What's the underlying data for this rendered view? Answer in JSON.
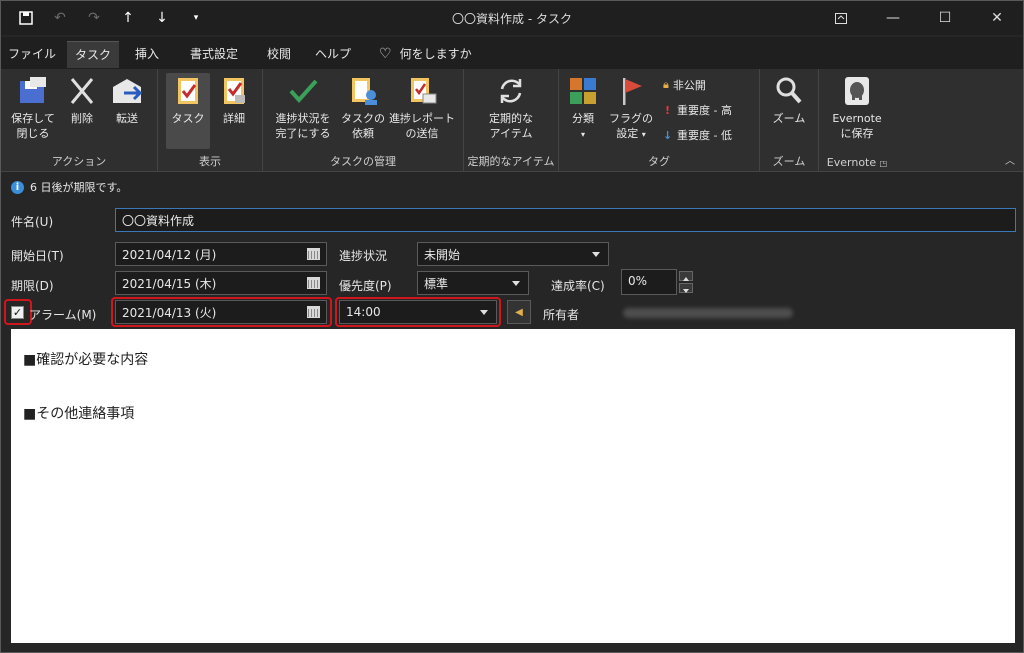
{
  "window": {
    "title": "〇〇資料作成 - タスク"
  },
  "tabs": [
    "ファイル",
    "タスク",
    "挿入",
    "書式設定",
    "校閲",
    "ヘルプ",
    "何をしますか"
  ],
  "ribbon": {
    "actions": {
      "label": "アクション",
      "save_close_1": "保存して",
      "save_close_2": "閉じる",
      "delete": "削除",
      "forward": "転送"
    },
    "show": {
      "label": "表示",
      "task": "タスク",
      "details": "詳細"
    },
    "manage": {
      "label": "タスクの管理",
      "complete_1": "進捗状況を",
      "complete_2": "完了にする",
      "assign_1": "タスクの",
      "assign_2": "依頼",
      "report_1": "進捗レポート",
      "report_2": "の送信"
    },
    "recurrence": {
      "label": "定期的なアイテム",
      "btn_1": "定期的な",
      "btn_2": "アイテム"
    },
    "tags": {
      "label": "タグ",
      "categorize": "分類",
      "flag_1": "フラグの",
      "flag_2": "設定",
      "private": "非公開",
      "high": "重要度 - 高",
      "low": "重要度 - 低"
    },
    "zoom": {
      "label": "ズーム",
      "btn": "ズーム"
    },
    "evernote": {
      "label": "Evernote",
      "btn_1": "Evernote",
      "btn_2": "に保存"
    }
  },
  "info": "6 日後が期限です。",
  "form": {
    "subject_label": "件名(U)",
    "subject": "〇〇資料作成",
    "start_label": "開始日(T)",
    "start": "2021/04/12 (月)",
    "due_label": "期限(D)",
    "due": "2021/04/15 (木)",
    "status_label": "進捗状況",
    "status": "未開始",
    "priority_label": "優先度(P)",
    "priority": "標準",
    "complete_label": "達成率(C)",
    "complete": "0%",
    "reminder_label": "アラーム(M)",
    "reminder_checked": true,
    "reminder_date": "2021/04/13 (火)",
    "reminder_time": "14:00",
    "owner_label": "所有者"
  },
  "body": {
    "line1": "■確認が必要な内容",
    "line2": "■その他連絡事項"
  },
  "colors": {
    "highlight": "#d0161c",
    "accent": "#3b8ed8"
  }
}
